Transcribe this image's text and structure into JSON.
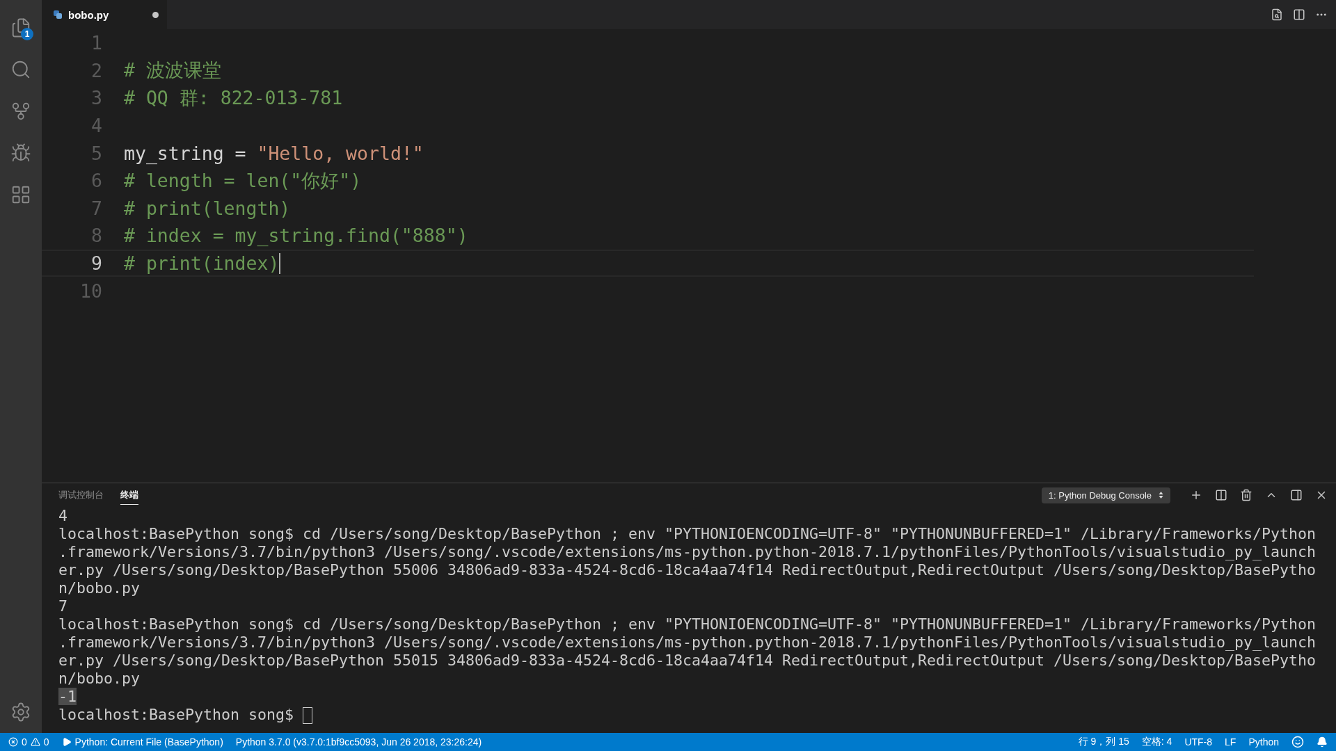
{
  "activity_bar": {
    "items": [
      {
        "kind": "files",
        "badge": "1"
      },
      {
        "kind": "search"
      },
      {
        "kind": "source-control"
      },
      {
        "kind": "debug"
      },
      {
        "kind": "extensions"
      }
    ],
    "bottom": [
      {
        "kind": "settings"
      }
    ]
  },
  "tabs": [
    {
      "label": "bobo.py",
      "selected": true,
      "modified": true
    }
  ],
  "editor_actions": [
    {
      "kind": "find-file"
    },
    {
      "kind": "split"
    },
    {
      "kind": "more"
    }
  ],
  "editor": {
    "lines": [
      {
        "number": "1",
        "current": false
      },
      {
        "number": "2",
        "current": false,
        "tokens": [
          {
            "kind": "comment",
            "text": "# 波波课堂"
          }
        ]
      },
      {
        "number": "3",
        "current": false,
        "tokens": [
          {
            "kind": "comment",
            "text": "# QQ 群: 822-013-781"
          }
        ]
      },
      {
        "number": "4",
        "current": false
      },
      {
        "number": "5",
        "current": false,
        "tokens": [
          {
            "kind": "plain",
            "text": "my_string = "
          },
          {
            "kind": "string",
            "text": "\"Hello, world!\""
          }
        ]
      },
      {
        "number": "6",
        "current": false,
        "tokens": [
          {
            "kind": "comment",
            "text": "# length = len(\"你好\")"
          }
        ]
      },
      {
        "number": "7",
        "current": false,
        "tokens": [
          {
            "kind": "comment",
            "text": "# print(length)"
          }
        ]
      },
      {
        "number": "8",
        "current": false,
        "tokens": [
          {
            "kind": "comment",
            "text": "# index = my_string.find(\"888\")"
          }
        ]
      },
      {
        "number": "9",
        "current": true,
        "tokens": [
          {
            "kind": "comment",
            "text": "# print(index)"
          }
        ]
      },
      {
        "number": "10",
        "current": false
      }
    ]
  },
  "panel": {
    "tabs": [
      {
        "label": "调试控制台",
        "selected": false
      },
      {
        "label": "终端",
        "selected": true
      }
    ],
    "terminal_select": "1: Python Debug Console",
    "actions": [
      {
        "kind": "add"
      },
      {
        "kind": "split"
      },
      {
        "kind": "trash"
      },
      {
        "kind": "maximize"
      },
      {
        "kind": "layout"
      },
      {
        "kind": "close"
      }
    ],
    "terminal_lines": [
      {
        "text": "4",
        "highlighted": false
      },
      {
        "text": "localhost:BasePython song$ cd /Users/song/Desktop/BasePython ; env \"PYTHONIOENCODING=UTF-8\" \"PYTHONUNBUFFERED=1\" /Library/Frameworks/Python",
        "highlighted": false
      },
      {
        "text": ".framework/Versions/3.7/bin/python3 /Users/song/.vscode/extensions/ms-python.python-2018.7.1/pythonFiles/PythonTools/visualstudio_py_launch",
        "highlighted": false
      },
      {
        "text": "er.py /Users/song/Desktop/BasePython 55006 34806ad9-833a-4524-8cd6-18ca4aa74f14 RedirectOutput,RedirectOutput /Users/song/Desktop/BasePytho",
        "highlighted": false
      },
      {
        "text": "n/bobo.py",
        "highlighted": false
      },
      {
        "text": "7",
        "highlighted": false
      },
      {
        "text": "localhost:BasePython song$ cd /Users/song/Desktop/BasePython ; env \"PYTHONIOENCODING=UTF-8\" \"PYTHONUNBUFFERED=1\" /Library/Frameworks/Python",
        "highlighted": false
      },
      {
        "text": ".framework/Versions/3.7/bin/python3 /Users/song/.vscode/extensions/ms-python.python-2018.7.1/pythonFiles/PythonTools/visualstudio_py_launch",
        "highlighted": false
      },
      {
        "text": "er.py /Users/song/Desktop/BasePython 55015 34806ad9-833a-4524-8cd6-18ca4aa74f14 RedirectOutput,RedirectOutput /Users/song/Desktop/BasePytho",
        "highlighted": false
      },
      {
        "text": "n/bobo.py",
        "highlighted": false
      },
      {
        "text": "-1",
        "highlighted": true
      }
    ],
    "prompt": "localhost:BasePython song$ "
  },
  "status_bar": {
    "left": [
      {
        "kind": "problems",
        "errors": "0",
        "warnings": "0"
      },
      {
        "kind": "run",
        "text": "Python: Current File (BasePython)"
      },
      {
        "kind": "text",
        "text": "Python 3.7.0 (v3.7.0:1bf9cc5093, Jun 26 2018, 23:26:24)"
      }
    ],
    "right": [
      {
        "kind": "text",
        "text": "行 9，列 15"
      },
      {
        "kind": "text",
        "text": "空格: 4"
      },
      {
        "kind": "text",
        "text": "UTF-8"
      },
      {
        "kind": "text",
        "text": "LF"
      },
      {
        "kind": "text",
        "text": "Python"
      },
      {
        "kind": "smiley"
      },
      {
        "kind": "bell"
      }
    ]
  }
}
